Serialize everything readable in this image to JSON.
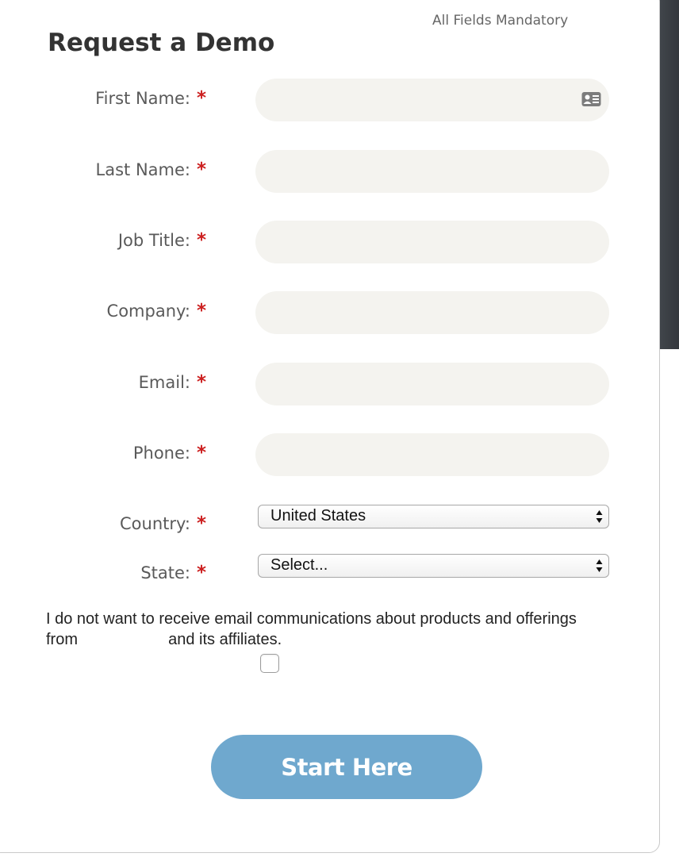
{
  "form": {
    "mandatory_note": "All Fields Mandatory",
    "title": "Request a Demo",
    "required_marker": "*",
    "fields": {
      "first_name": {
        "label": "First Name:",
        "value": "",
        "placeholder": ""
      },
      "last_name": {
        "label": "Last Name:",
        "value": "",
        "placeholder": ""
      },
      "job_title": {
        "label": "Job Title:",
        "value": "",
        "placeholder": ""
      },
      "company": {
        "label": "Company:",
        "value": "",
        "placeholder": ""
      },
      "email": {
        "label": "Email:",
        "value": "",
        "placeholder": ""
      },
      "phone": {
        "label": "Phone:",
        "value": "",
        "placeholder": ""
      }
    },
    "country": {
      "label": "Country:",
      "selected": "United States"
    },
    "state": {
      "label": "State:",
      "selected": "Select..."
    },
    "consent": {
      "text_before": "I do not want to receive email communications about products and offerings from",
      "text_after": "and its affiliates.",
      "checked": false
    },
    "submit_label": "Start Here"
  },
  "icons": {
    "autofill": "contact-card-icon",
    "select_arrows": "up-down-arrows-icon"
  },
  "colors": {
    "required": "#cc1f1f",
    "field_background": "#f4f3ef",
    "submit_background": "#6fa8ce",
    "title": "#333333"
  }
}
